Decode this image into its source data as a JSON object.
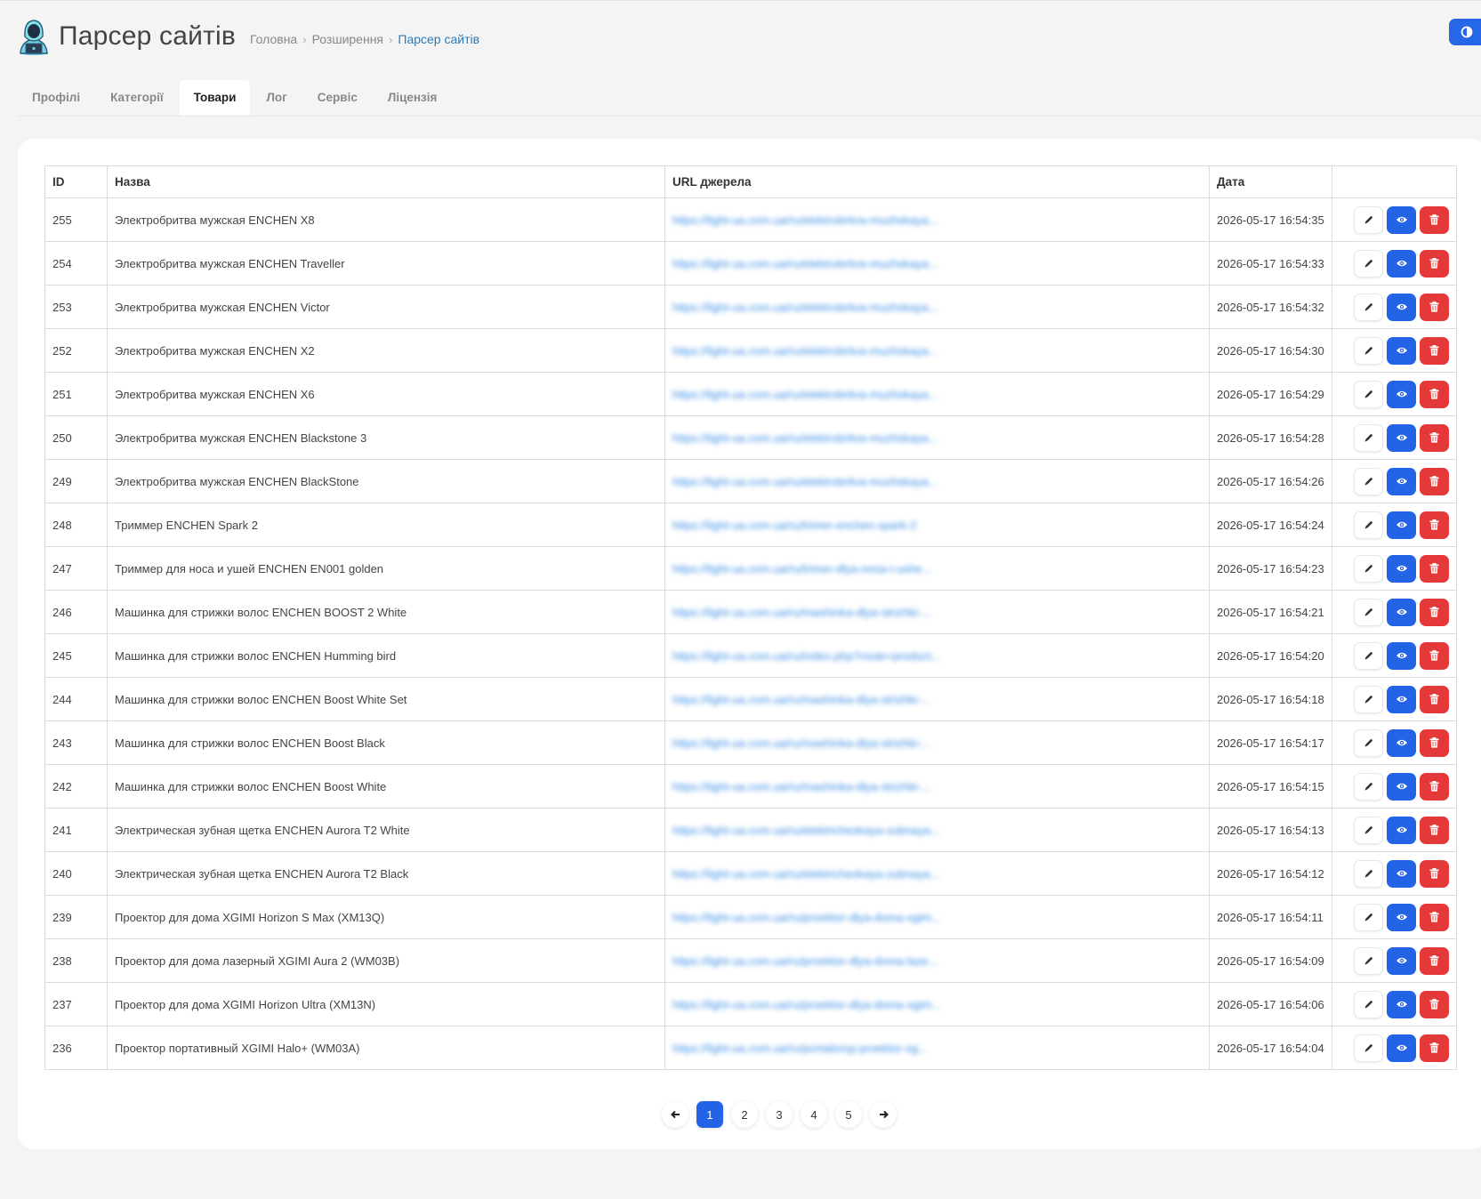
{
  "header": {
    "title": "Парсер сайтів",
    "breadcrumb": [
      "Головна",
      "Розширення",
      "Парсер сайтів"
    ]
  },
  "tabs": [
    "Профілі",
    "Категорії",
    "Товари",
    "Лог",
    "Сервіс",
    "Ліцензія"
  ],
  "active_tab": "Товари",
  "table": {
    "columns": [
      "ID",
      "Назва",
      "URL джерела",
      "Дата",
      ""
    ],
    "rows": [
      {
        "id": "255",
        "name": "Электробритва мужская ENCHEN X8",
        "url": "https://light-ua.com.ua/ru/elektrobritva-muzhskaya...",
        "date": "2026-05-17 16:54:35"
      },
      {
        "id": "254",
        "name": "Электробритва мужская ENCHEN Traveller",
        "url": "https://light-ua.com.ua/ru/elektrobritva-muzhskaya...",
        "date": "2026-05-17 16:54:33"
      },
      {
        "id": "253",
        "name": "Электробритва мужская ENCHEN Victor",
        "url": "https://light-ua.com.ua/ru/elektrobritva-muzhskaya...",
        "date": "2026-05-17 16:54:32"
      },
      {
        "id": "252",
        "name": "Электробритва мужская ENCHEN X2",
        "url": "https://light-ua.com.ua/ru/elektrobritva-muzhskaya...",
        "date": "2026-05-17 16:54:30"
      },
      {
        "id": "251",
        "name": "Электробритва мужская ENCHEN X6",
        "url": "https://light-ua.com.ua/ru/elektrobritva-muzhskaya...",
        "date": "2026-05-17 16:54:29"
      },
      {
        "id": "250",
        "name": "Электробритва мужская ENCHEN Blackstone 3",
        "url": "https://light-ua.com.ua/ru/elektrobritva-muzhskaya...",
        "date": "2026-05-17 16:54:28"
      },
      {
        "id": "249",
        "name": "Электробритва мужская ENCHEN BlackStone",
        "url": "https://light-ua.com.ua/ru/elektrobritva-muzhskaya...",
        "date": "2026-05-17 16:54:26"
      },
      {
        "id": "248",
        "name": "Триммер ENCHEN Spark 2",
        "url": "https://light-ua.com.ua/ru/trimer-enchen-spark-2",
        "date": "2026-05-17 16:54:24"
      },
      {
        "id": "247",
        "name": "Триммер для носа и ушей ENCHEN EN001 golden",
        "url": "https://light-ua.com.ua/ru/trimer-dlya-nosa-i-ushe...",
        "date": "2026-05-17 16:54:23"
      },
      {
        "id": "246",
        "name": "Машинка для стрижки волос ENCHEN BOOST 2 White",
        "url": "https://light-ua.com.ua/ru/mashinka-dlya-strizhki-...",
        "date": "2026-05-17 16:54:21"
      },
      {
        "id": "245",
        "name": "Машинка для стрижки волос ENCHEN Humming bird",
        "url": "https://light-ua.com.ua/ru/index.php?route=product...",
        "date": "2026-05-17 16:54:20"
      },
      {
        "id": "244",
        "name": "Машинка для стрижки волос ENCHEN Boost White Set",
        "url": "https://light-ua.com.ua/ru/mashinka-dlya-strizhki-...",
        "date": "2026-05-17 16:54:18"
      },
      {
        "id": "243",
        "name": "Машинка для стрижки волос ENCHEN Boost Black",
        "url": "https://light-ua.com.ua/ru/mashinka-dlya-strizhki-...",
        "date": "2026-05-17 16:54:17"
      },
      {
        "id": "242",
        "name": "Машинка для стрижки волос ENCHEN Boost White",
        "url": "https://light-ua.com.ua/ru/mashinka-dlya-strizhki-...",
        "date": "2026-05-17 16:54:15"
      },
      {
        "id": "241",
        "name": "Электрическая зубная щетка ENCHEN Aurora T2 White",
        "url": "https://light-ua.com.ua/ru/elektricheskaya-zubnaya...",
        "date": "2026-05-17 16:54:13"
      },
      {
        "id": "240",
        "name": "Электрическая зубная щетка ENCHEN Aurora T2 Black",
        "url": "https://light-ua.com.ua/ru/elektricheskaya-zubnaya...",
        "date": "2026-05-17 16:54:12"
      },
      {
        "id": "239",
        "name": "Проектор для дома XGIMI Horizon S Max (XM13Q)",
        "url": "https://light-ua.com.ua/ru/proektor-dlya-doma-xgim...",
        "date": "2026-05-17 16:54:11"
      },
      {
        "id": "238",
        "name": "Проектор для дома лазерный XGIMI Aura 2 (WM03B)",
        "url": "https://light-ua.com.ua/ru/proektor-dlya-doma-lazе...",
        "date": "2026-05-17 16:54:09"
      },
      {
        "id": "237",
        "name": "Проектор для дома XGIMI Horizon Ultra (XM13N)",
        "url": "https://light-ua.com.ua/ru/proektor-dlya-doma-xgim...",
        "date": "2026-05-17 16:54:06"
      },
      {
        "id": "236",
        "name": "Проектор портативный XGIMI Halo+ (WM03A)",
        "url": "https://light-ua.com.ua/ru/portativnyj-proektor-xg...",
        "date": "2026-05-17 16:54:04"
      }
    ]
  },
  "pagination": {
    "pages": [
      "1",
      "2",
      "3",
      "4",
      "5"
    ],
    "current": "1",
    "prev_icon": "arrow-left-icon",
    "next_icon": "arrow-right-icon"
  },
  "colors": {
    "primary": "#2364e6",
    "danger": "#e53939",
    "link": "#2a7ab5"
  }
}
